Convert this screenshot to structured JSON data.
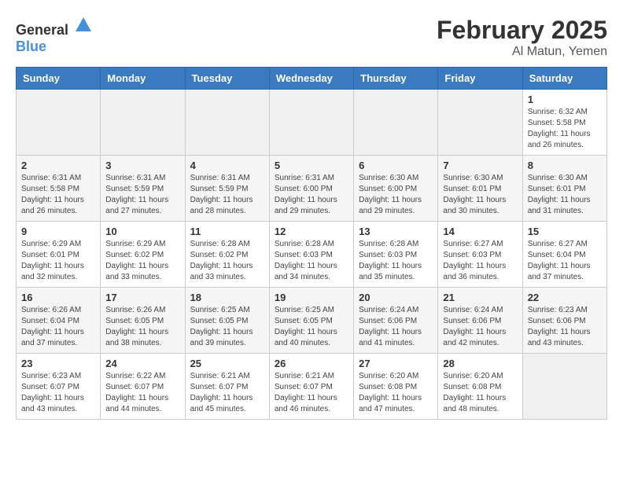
{
  "header": {
    "logo_general": "General",
    "logo_blue": "Blue",
    "title": "February 2025",
    "subtitle": "Al Matun, Yemen"
  },
  "days_of_week": [
    "Sunday",
    "Monday",
    "Tuesday",
    "Wednesday",
    "Thursday",
    "Friday",
    "Saturday"
  ],
  "weeks": [
    [
      {
        "day": null
      },
      {
        "day": null
      },
      {
        "day": null
      },
      {
        "day": null
      },
      {
        "day": null
      },
      {
        "day": null
      },
      {
        "day": "1",
        "sunrise": "Sunrise: 6:32 AM",
        "sunset": "Sunset: 5:58 PM",
        "daylight": "Daylight: 11 hours and 26 minutes."
      }
    ],
    [
      {
        "day": "2",
        "sunrise": "Sunrise: 6:31 AM",
        "sunset": "Sunset: 5:58 PM",
        "daylight": "Daylight: 11 hours and 26 minutes."
      },
      {
        "day": "3",
        "sunrise": "Sunrise: 6:31 AM",
        "sunset": "Sunset: 5:59 PM",
        "daylight": "Daylight: 11 hours and 27 minutes."
      },
      {
        "day": "4",
        "sunrise": "Sunrise: 6:31 AM",
        "sunset": "Sunset: 5:59 PM",
        "daylight": "Daylight: 11 hours and 28 minutes."
      },
      {
        "day": "5",
        "sunrise": "Sunrise: 6:31 AM",
        "sunset": "Sunset: 6:00 PM",
        "daylight": "Daylight: 11 hours and 29 minutes."
      },
      {
        "day": "6",
        "sunrise": "Sunrise: 6:30 AM",
        "sunset": "Sunset: 6:00 PM",
        "daylight": "Daylight: 11 hours and 29 minutes."
      },
      {
        "day": "7",
        "sunrise": "Sunrise: 6:30 AM",
        "sunset": "Sunset: 6:01 PM",
        "daylight": "Daylight: 11 hours and 30 minutes."
      },
      {
        "day": "8",
        "sunrise": "Sunrise: 6:30 AM",
        "sunset": "Sunset: 6:01 PM",
        "daylight": "Daylight: 11 hours and 31 minutes."
      }
    ],
    [
      {
        "day": "9",
        "sunrise": "Sunrise: 6:29 AM",
        "sunset": "Sunset: 6:01 PM",
        "daylight": "Daylight: 11 hours and 32 minutes."
      },
      {
        "day": "10",
        "sunrise": "Sunrise: 6:29 AM",
        "sunset": "Sunset: 6:02 PM",
        "daylight": "Daylight: 11 hours and 33 minutes."
      },
      {
        "day": "11",
        "sunrise": "Sunrise: 6:28 AM",
        "sunset": "Sunset: 6:02 PM",
        "daylight": "Daylight: 11 hours and 33 minutes."
      },
      {
        "day": "12",
        "sunrise": "Sunrise: 6:28 AM",
        "sunset": "Sunset: 6:03 PM",
        "daylight": "Daylight: 11 hours and 34 minutes."
      },
      {
        "day": "13",
        "sunrise": "Sunrise: 6:28 AM",
        "sunset": "Sunset: 6:03 PM",
        "daylight": "Daylight: 11 hours and 35 minutes."
      },
      {
        "day": "14",
        "sunrise": "Sunrise: 6:27 AM",
        "sunset": "Sunset: 6:03 PM",
        "daylight": "Daylight: 11 hours and 36 minutes."
      },
      {
        "day": "15",
        "sunrise": "Sunrise: 6:27 AM",
        "sunset": "Sunset: 6:04 PM",
        "daylight": "Daylight: 11 hours and 37 minutes."
      }
    ],
    [
      {
        "day": "16",
        "sunrise": "Sunrise: 6:26 AM",
        "sunset": "Sunset: 6:04 PM",
        "daylight": "Daylight: 11 hours and 37 minutes."
      },
      {
        "day": "17",
        "sunrise": "Sunrise: 6:26 AM",
        "sunset": "Sunset: 6:05 PM",
        "daylight": "Daylight: 11 hours and 38 minutes."
      },
      {
        "day": "18",
        "sunrise": "Sunrise: 6:25 AM",
        "sunset": "Sunset: 6:05 PM",
        "daylight": "Daylight: 11 hours and 39 minutes."
      },
      {
        "day": "19",
        "sunrise": "Sunrise: 6:25 AM",
        "sunset": "Sunset: 6:05 PM",
        "daylight": "Daylight: 11 hours and 40 minutes."
      },
      {
        "day": "20",
        "sunrise": "Sunrise: 6:24 AM",
        "sunset": "Sunset: 6:06 PM",
        "daylight": "Daylight: 11 hours and 41 minutes."
      },
      {
        "day": "21",
        "sunrise": "Sunrise: 6:24 AM",
        "sunset": "Sunset: 6:06 PM",
        "daylight": "Daylight: 11 hours and 42 minutes."
      },
      {
        "day": "22",
        "sunrise": "Sunrise: 6:23 AM",
        "sunset": "Sunset: 6:06 PM",
        "daylight": "Daylight: 11 hours and 43 minutes."
      }
    ],
    [
      {
        "day": "23",
        "sunrise": "Sunrise: 6:23 AM",
        "sunset": "Sunset: 6:07 PM",
        "daylight": "Daylight: 11 hours and 43 minutes."
      },
      {
        "day": "24",
        "sunrise": "Sunrise: 6:22 AM",
        "sunset": "Sunset: 6:07 PM",
        "daylight": "Daylight: 11 hours and 44 minutes."
      },
      {
        "day": "25",
        "sunrise": "Sunrise: 6:21 AM",
        "sunset": "Sunset: 6:07 PM",
        "daylight": "Daylight: 11 hours and 45 minutes."
      },
      {
        "day": "26",
        "sunrise": "Sunrise: 6:21 AM",
        "sunset": "Sunset: 6:07 PM",
        "daylight": "Daylight: 11 hours and 46 minutes."
      },
      {
        "day": "27",
        "sunrise": "Sunrise: 6:20 AM",
        "sunset": "Sunset: 6:08 PM",
        "daylight": "Daylight: 11 hours and 47 minutes."
      },
      {
        "day": "28",
        "sunrise": "Sunrise: 6:20 AM",
        "sunset": "Sunset: 6:08 PM",
        "daylight": "Daylight: 11 hours and 48 minutes."
      },
      {
        "day": null
      }
    ]
  ]
}
